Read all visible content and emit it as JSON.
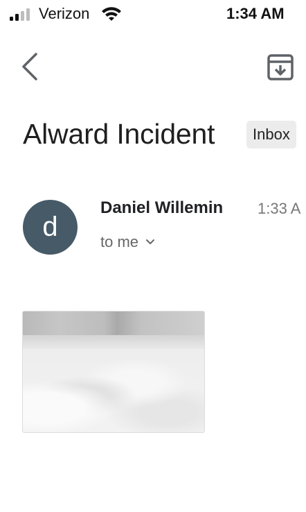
{
  "status_bar": {
    "carrier": "Verizon",
    "time": "1:34 AM",
    "signal_bars_active": 2,
    "signal_bars_total": 4
  },
  "toolbar": {
    "back_icon": "chevron-left-icon",
    "archive_icon": "archive-icon"
  },
  "email": {
    "subject": "Alward Incident",
    "label": "Inbox",
    "sender_initial": "d",
    "sender_name": "Daniel Willemin",
    "timestamp": "1:33 A",
    "recipient": "to me",
    "avatar_color": "#475a68"
  },
  "attachment": {
    "blurred": true
  }
}
